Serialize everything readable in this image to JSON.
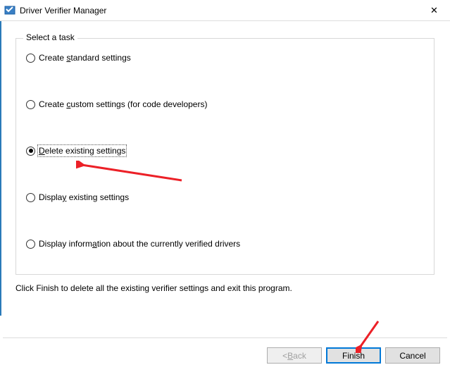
{
  "window": {
    "title": "Driver Verifier Manager"
  },
  "group": {
    "legend": "Select a task"
  },
  "options": {
    "create_standard_pre": "Create ",
    "create_standard_u": "s",
    "create_standard_post": "tandard settings",
    "create_custom_pre": "Create ",
    "create_custom_u": "c",
    "create_custom_post": "ustom settings (for code developers)",
    "delete_pre": "",
    "delete_u": "D",
    "delete_post": "elete existing settings",
    "display_pre": "Displa",
    "display_u": "y",
    "display_post": " existing settings",
    "display_info_pre": "Display inform",
    "display_info_u": "a",
    "display_info_post": "tion about the currently verified drivers"
  },
  "instruction": "Click Finish to delete all the existing verifier settings and exit this program.",
  "buttons": {
    "back_pre": "< ",
    "back_u": "B",
    "back_post": "ack",
    "finish": "Finish",
    "cancel": "Cancel"
  }
}
